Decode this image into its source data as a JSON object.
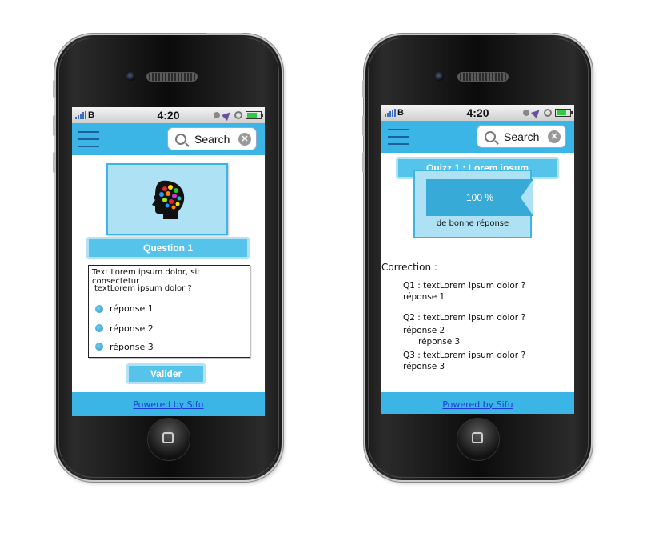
{
  "status_bar": {
    "carrier": "B",
    "time": "4:20"
  },
  "search": {
    "label": "Search"
  },
  "left_screen": {
    "question_title": "Question 1",
    "question_text_line1": "Text Lorem ipsum dolor, sit consectetur",
    "question_text_line2": "textLorem ipsum dolor ?",
    "answers": [
      "réponse 1",
      "réponse 2",
      "réponse 3"
    ],
    "submit_label": "Valider",
    "footer_link": "Powered by Sifu"
  },
  "right_screen": {
    "quiz_title": "Quizz 1 : Lorem ipsum",
    "score_percent": "100 %",
    "score_label": "de bonne réponse",
    "correction_title": "Correction :",
    "corrections": [
      {
        "question": "Q1 : textLorem ipsum dolor ?",
        "answers": [
          "réponse 1"
        ]
      },
      {
        "question": "Q2 : textLorem ipsum dolor ?",
        "answers": [
          "réponse 2",
          "réponse 3"
        ]
      },
      {
        "question": "Q3 : textLorem ipsum dolor ?",
        "answers": [
          "réponse 3"
        ]
      }
    ],
    "footer_link": "Powered by Sifu"
  },
  "colors": {
    "accent": "#3bb5e6",
    "pill": "#56c3ea",
    "card": "#aee1f4",
    "link": "#1a3cd6"
  }
}
